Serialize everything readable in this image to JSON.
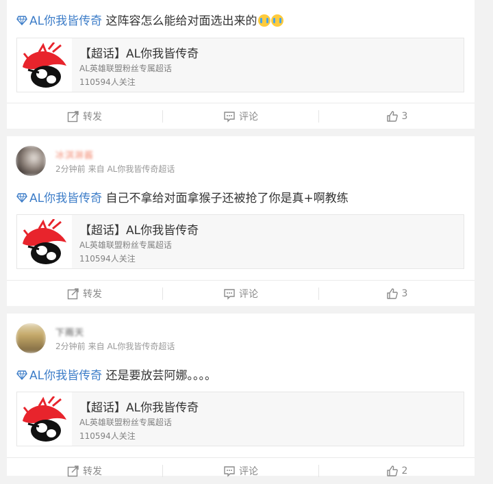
{
  "posts": [
    {
      "topic": "AL你我皆传奇",
      "body": "这阵容怎么能给对面选出来的",
      "share": {
        "title": "【超话】AL你我皆传奇",
        "desc": "AL英雄联盟粉丝专属超话",
        "followers": "110594人关注"
      },
      "actions": {
        "repost": "转发",
        "comment": "评论",
        "like_count": "3"
      }
    },
    {
      "nickname": "冰淇淋酱",
      "time": "2分钟前",
      "source": "来自 AL你我皆传奇超话",
      "topic": "AL你我皆传奇",
      "body": "自己不拿给对面拿猴子还被抢了你是真+啊教练",
      "share": {
        "title": "【超话】AL你我皆传奇",
        "desc": "AL英雄联盟粉丝专属超话",
        "followers": "110594人关注"
      },
      "actions": {
        "repost": "转发",
        "comment": "评论",
        "like_count": "3"
      }
    },
    {
      "nickname": "下雨天",
      "time": "2分钟前",
      "source": "来自 AL你我皆传奇超话",
      "topic": "AL你我皆传奇",
      "body": "还是要放芸阿娜。。。。",
      "share": {
        "title": "【超话】AL你我皆传奇",
        "desc": "AL英雄联盟粉丝专属超话",
        "followers": "110594人关注"
      },
      "actions": {
        "repost": "转发",
        "comment": "评论",
        "like_count": "2"
      }
    }
  ],
  "colors": {
    "topic": "#3d7dc8",
    "background": "#f2f2f2",
    "card": "#ffffff"
  },
  "icons": [
    "diamond-icon",
    "repost-icon",
    "comment-icon",
    "like-icon",
    "crying-emoji-icon"
  ]
}
